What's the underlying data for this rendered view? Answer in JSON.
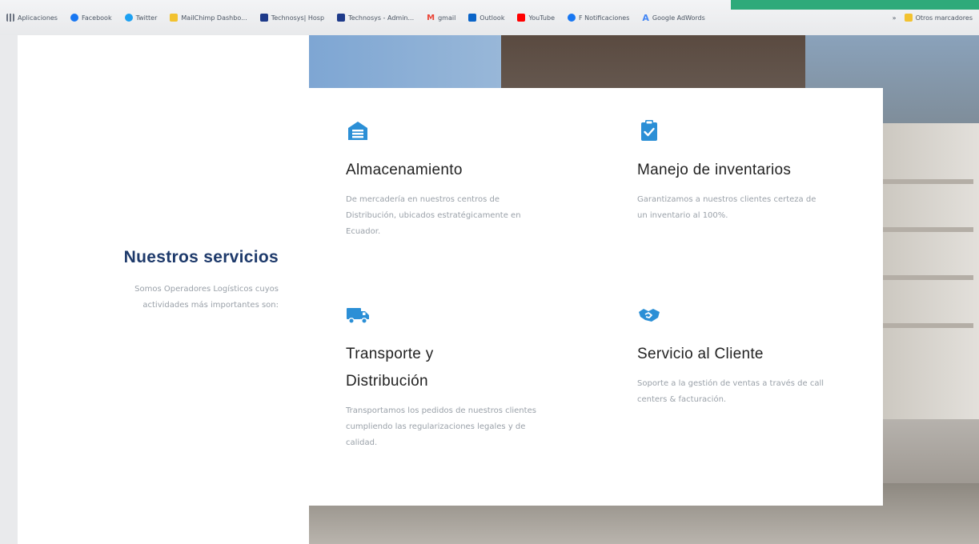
{
  "bookmarks": [
    {
      "label": "Aplicaciones",
      "color": "#6b7280"
    },
    {
      "label": "Facebook",
      "color": "#1877f2"
    },
    {
      "label": "Twitter",
      "color": "#1da1f2"
    },
    {
      "label": "MailChimp Dashbo...",
      "color": "#f2c230"
    },
    {
      "label": "Technosys| Hosp",
      "color": "#1e3a8a"
    },
    {
      "label": "Technosys - Admin...",
      "color": "#1e3a8a"
    },
    {
      "label": "gmail",
      "color": "#ea4335"
    },
    {
      "label": "Outlook",
      "color": "#0a64c8"
    },
    {
      "label": "YouTube",
      "color": "#ff0000"
    },
    {
      "label": "F Notificaciones",
      "color": "#1877f2"
    },
    {
      "label": "Google AdWords",
      "color": "#4285f4"
    }
  ],
  "bookmarks_more": "»",
  "other_bookmarks": "Otros marcadores",
  "sidebar": {
    "title": "Nuestros servicios",
    "description": "Somos Operadores Logísticos cuyos actividades más importantes son:"
  },
  "services": [
    {
      "icon": "warehouse-icon",
      "name": "Almacenamiento",
      "description": "De mercadería en nuestros centros de Distribución, ubicados estratégicamente en Ecuador."
    },
    {
      "icon": "clipboard-check-icon",
      "name": "Manejo de inventarios",
      "description": "Garantizamos a nuestros clientes certeza de un inventario al 100%."
    },
    {
      "icon": "truck-icon",
      "name": "Transporte y Distribución",
      "description": "Transportamos los pedidos de nuestros clientes cumpliendo las regularizaciones legales y de calidad."
    },
    {
      "icon": "handshake-icon",
      "name": "Servicio al Cliente",
      "description": "Soporte a la gestión de ventas a través de call centers & facturación."
    }
  ],
  "colors": {
    "accent": "#2b8fd6",
    "heading": "#1e3a6b",
    "bar_accent": "#2eaa7a"
  }
}
